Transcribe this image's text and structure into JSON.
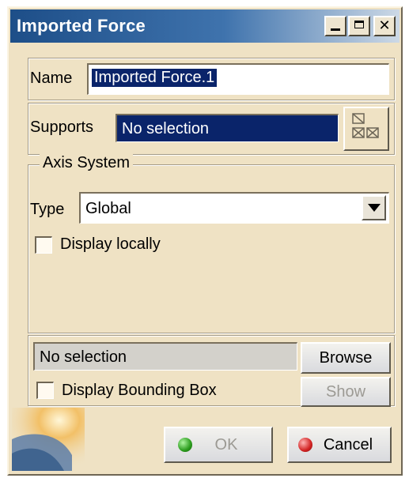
{
  "window": {
    "title": "Imported Force"
  },
  "titlebar_buttons": {
    "minimize": "minimize",
    "maximize": "maximize",
    "close": "✕"
  },
  "name": {
    "label": "Name",
    "value": "Imported Force.1"
  },
  "supports": {
    "label": "Supports",
    "value": "No selection",
    "icon": "select-elements-icon"
  },
  "axis_system": {
    "legend": "Axis System",
    "type_label": "Type",
    "type_value": "Global",
    "display_locally": {
      "label": "Display locally",
      "checked": false
    }
  },
  "data_file": {
    "selection": "No selection",
    "browse_label": "Browse",
    "show_label": "Show",
    "display_bounding_box": {
      "label": "Display Bounding Box",
      "checked": false
    }
  },
  "actions": {
    "ok_label": "OK",
    "cancel_label": "Cancel"
  },
  "colors": {
    "dialog_bg": "#efe2c4",
    "title_bar": "#1d4e88",
    "selection_bg": "#0a246a",
    "ok_indicator": "#2a9b1c",
    "cancel_indicator": "#d22222"
  }
}
